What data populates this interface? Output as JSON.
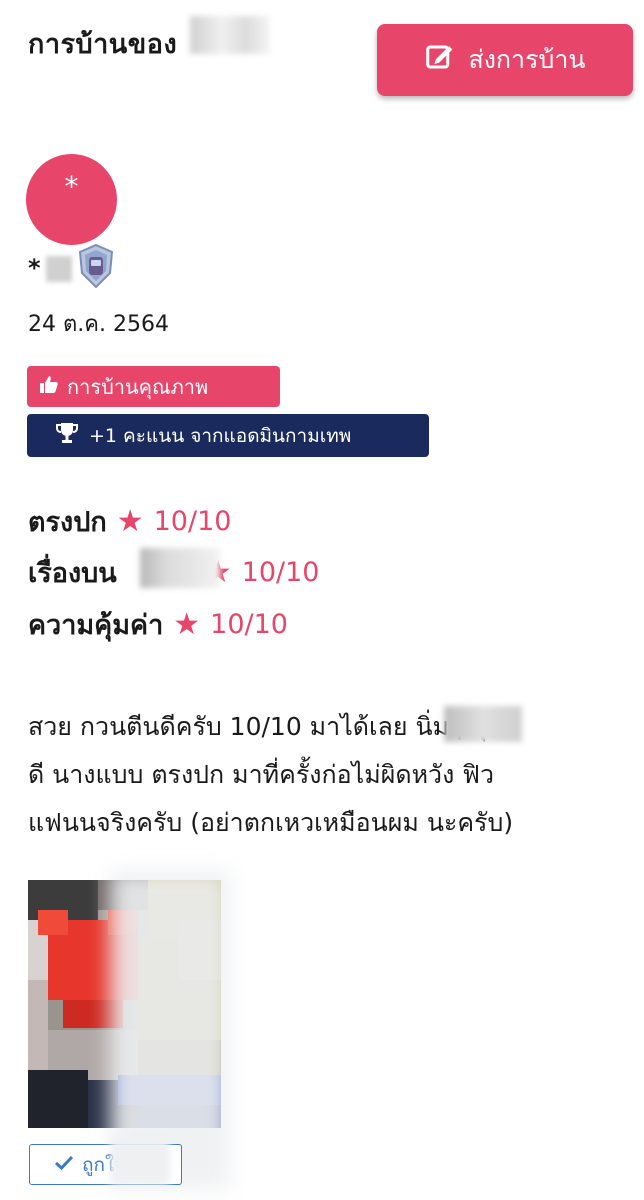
{
  "header": {
    "title": "การบ้านของ",
    "submit_label": "ส่งการบ้าน",
    "submit_icon": "edit-icon"
  },
  "author": {
    "avatar_initial": "*",
    "name": "*",
    "rank_icon": "shield-badge-icon",
    "date": "24 ต.ค. 2564"
  },
  "badges": {
    "quality_label": "การบ้านคุณภาพ",
    "quality_icon": "thumbs-up-icon",
    "bonus_label": "+1 คะแนน จากแอดมินกามเทพ",
    "bonus_icon": "trophy-icon"
  },
  "ratings": [
    {
      "label": "ตรงปก",
      "score": "10/10",
      "stars": 1
    },
    {
      "label": "เรื่องบน",
      "score": "10/10",
      "stars": 1
    },
    {
      "label": "ความคุ้มค่า",
      "score": "10/10",
      "stars": 1
    }
  ],
  "review": {
    "line1": "สวย กวนตีนดีครับ 10/10 มาได้เลย นิ่มๆ หุ่น",
    "line2": "ดี นางแบบ ตรงปก มาที่ครั้งก่อไม่ผิดหวัง ฟิว",
    "line3": "แฟนนจริงครับ (อย่าตกเหวเหมือนผม นะครับ)"
  },
  "vote": {
    "label": "ถูกใจ",
    "icon": "check-icon"
  },
  "colors": {
    "accent": "#e8456b",
    "navy": "#1b2a5c",
    "vote_blue": "#3c78c8"
  }
}
